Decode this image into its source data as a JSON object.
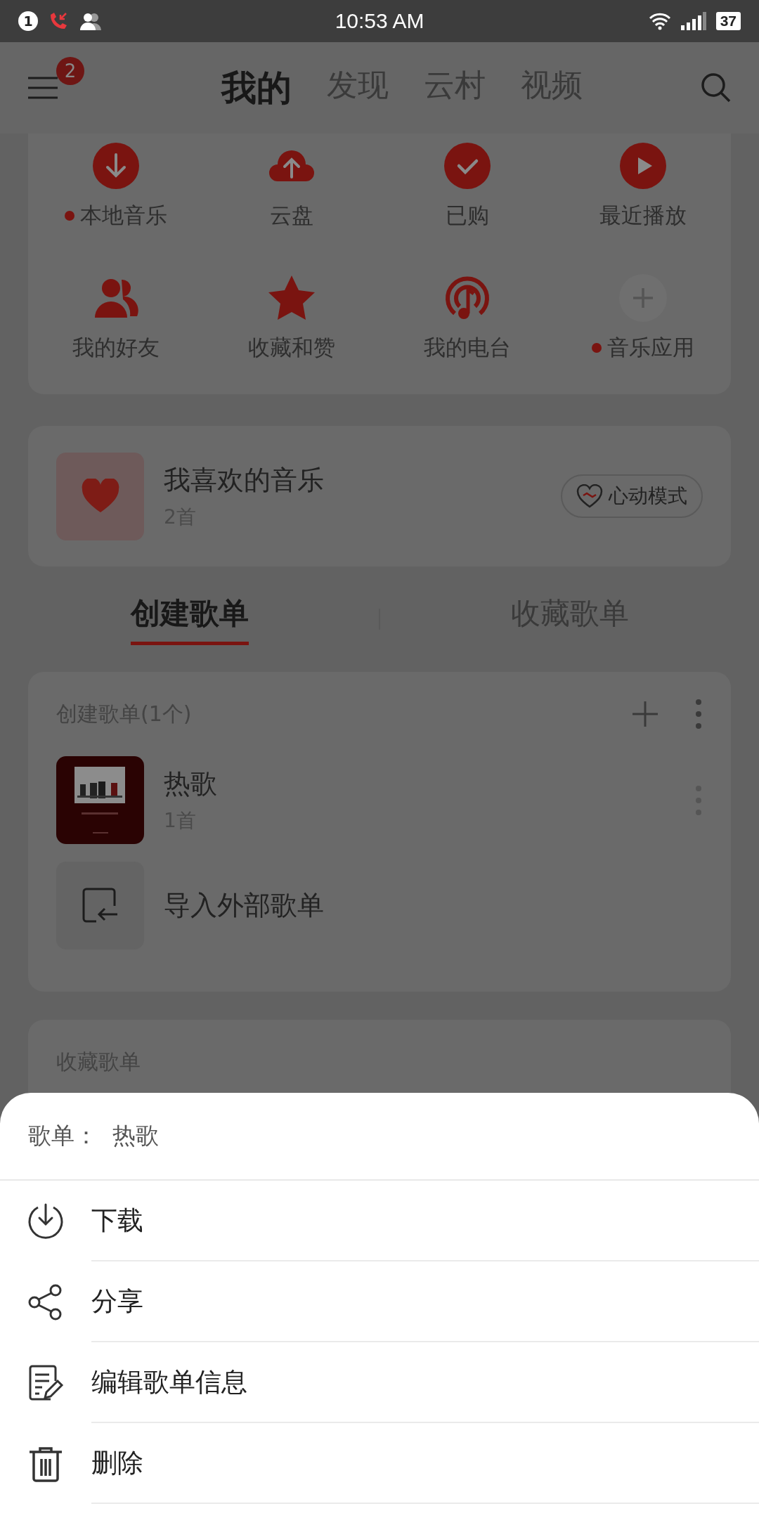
{
  "status_bar": {
    "notification_count": "1",
    "time": "10:53 AM",
    "battery": "37"
  },
  "header": {
    "menu_badge": "2",
    "tabs": [
      {
        "label": "我的",
        "selected": true
      },
      {
        "label": "发现",
        "selected": false
      },
      {
        "label": "云村",
        "selected": false
      },
      {
        "label": "视频",
        "selected": false
      }
    ]
  },
  "shortcuts": [
    {
      "label": "本地音乐",
      "dot": true
    },
    {
      "label": "云盘",
      "dot": false
    },
    {
      "label": "已购",
      "dot": false
    },
    {
      "label": "最近播放",
      "dot": false
    },
    {
      "label": "我的好友",
      "dot": false
    },
    {
      "label": "收藏和赞",
      "dot": false
    },
    {
      "label": "我的电台",
      "dot": false
    },
    {
      "label": "音乐应用",
      "dot": true
    }
  ],
  "liked": {
    "title": "我喜欢的音乐",
    "count": "2首",
    "mode_button": "心动模式"
  },
  "playlist_tabs": [
    {
      "label": "创建歌单",
      "selected": true
    },
    {
      "label": "收藏歌单",
      "selected": false
    }
  ],
  "created": {
    "header": "创建歌单(1个)",
    "playlists": [
      {
        "title": "热歌",
        "count": "1首",
        "kind": "picture"
      }
    ],
    "import_label": "导入外部歌单"
  },
  "collected": {
    "header": "收藏歌单"
  },
  "sheet": {
    "title": "歌单：  热歌",
    "items": [
      {
        "label": "下载"
      },
      {
        "label": "分享"
      },
      {
        "label": "编辑歌单信息"
      },
      {
        "label": "删除"
      }
    ]
  }
}
